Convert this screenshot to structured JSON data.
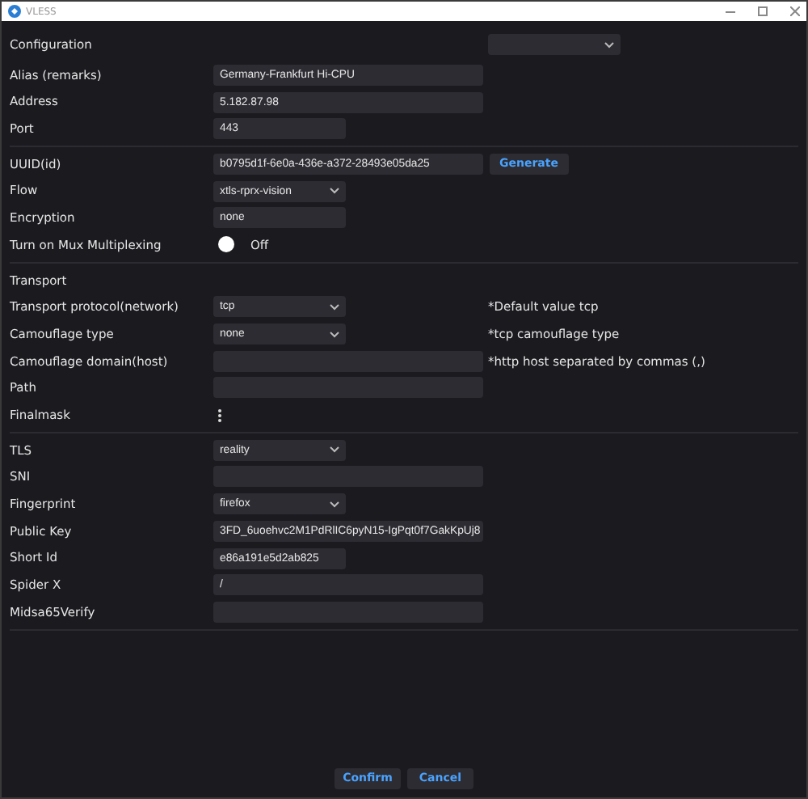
{
  "window": {
    "title": "VLESS"
  },
  "sections": [
    {
      "rows": [
        {
          "kind": "config-select",
          "label": "Configuration"
        },
        {
          "kind": "text",
          "label": "Alias (remarks)",
          "value": "Germany-Frankfurt Hi-CPU"
        },
        {
          "kind": "text",
          "label": "Address",
          "value": "5.182.87.98"
        },
        {
          "kind": "short-text",
          "label": "Port",
          "value": "443"
        }
      ]
    },
    {
      "rows": [
        {
          "kind": "text",
          "label": "UUID(id)",
          "value": "b0795d1f-6e0a-436e-a372-28493e05da25",
          "button": "Generate"
        },
        {
          "kind": "select",
          "label": "Flow",
          "value": "xtls-rprx-vision"
        },
        {
          "kind": "short-text",
          "label": "Encryption",
          "value": "none"
        },
        {
          "kind": "toggle",
          "label": "Turn on Mux Multiplexing",
          "on": false,
          "state_label": "Off"
        }
      ]
    },
    {
      "rows": [
        {
          "kind": "heading",
          "label": "Transport"
        },
        {
          "kind": "select",
          "label": "Transport protocol(network)",
          "value": "tcp",
          "note": "*Default value tcp"
        },
        {
          "kind": "select",
          "label": "Camouflage type",
          "value": "none",
          "note": "*tcp camouflage type"
        },
        {
          "kind": "text",
          "label": "Camouflage domain(host)",
          "note": "*http host separated by commas (,)"
        },
        {
          "kind": "text",
          "label": "Path"
        },
        {
          "kind": "menu",
          "label": "Finalmask"
        }
      ]
    },
    {
      "rows": [
        {
          "kind": "select",
          "label": "TLS",
          "value": "reality"
        },
        {
          "kind": "text",
          "label": "SNI"
        },
        {
          "kind": "select",
          "label": "Fingerprint",
          "value": "firefox"
        },
        {
          "kind": "text",
          "label": "Public Key",
          "value": "3FD_6uoehvc2M1PdRlIC6pyN15-IgPqt0f7GakKpUj8"
        },
        {
          "kind": "short-text",
          "label": "Short Id",
          "value": "e86a191e5d2ab825"
        },
        {
          "kind": "text",
          "label": "Spider X",
          "value": "/"
        },
        {
          "kind": "text",
          "label": "Midsa65Verify"
        }
      ]
    }
  ],
  "buttons": [
    "Confirm",
    "Cancel"
  ]
}
